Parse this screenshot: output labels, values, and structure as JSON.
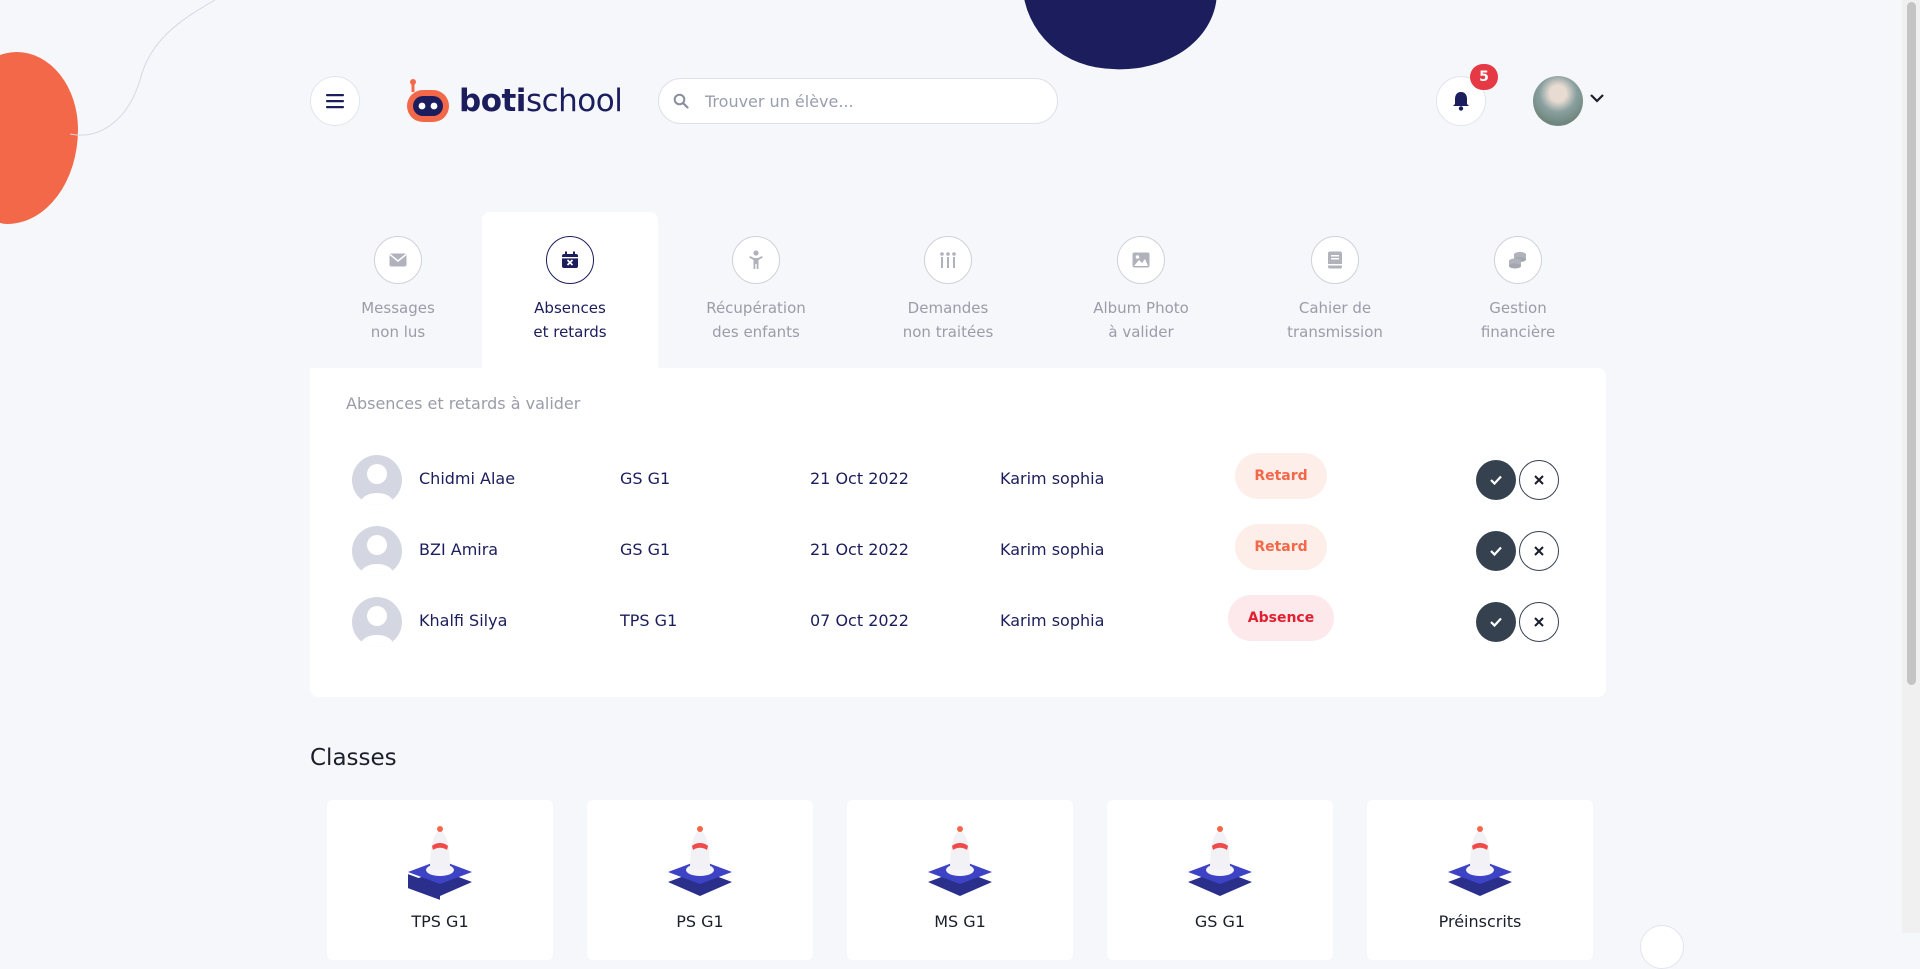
{
  "app": {
    "brand_part1": "boti",
    "brand_part2": "school"
  },
  "header": {
    "menu_icon": "hamburger-icon",
    "search": {
      "placeholder": "Trouver un élève...",
      "icon": "search-icon"
    },
    "notifications": {
      "icon": "bell-icon",
      "count": "5"
    },
    "user_menu": {
      "icon": "chevron-down-icon"
    }
  },
  "tabs": [
    {
      "line1": "Messages",
      "line2": "non lus",
      "icon": "envelope-icon",
      "active": false
    },
    {
      "line1": "Absences",
      "line2": "et retards",
      "icon": "calendar-x-icon",
      "active": true
    },
    {
      "line1": "Récupération",
      "line2": "des enfants",
      "icon": "child-icon",
      "active": false
    },
    {
      "line1": "Demandes",
      "line2": "non traitées",
      "icon": "list-icon",
      "active": false
    },
    {
      "line1": "Album Photo",
      "line2": "à valider",
      "icon": "image-icon",
      "active": false
    },
    {
      "line1": "Cahier de",
      "line2": "transmission",
      "icon": "book-icon",
      "active": false
    },
    {
      "line1": "Gestion",
      "line2": "financière",
      "icon": "coins-icon",
      "active": false
    }
  ],
  "panel": {
    "title": "Absences et retards à valider",
    "rows": [
      {
        "name": "Chidmi Alae",
        "class": "GS G1",
        "date": "21 Oct 2022",
        "teacher": "Karim sophia",
        "status": "Retard"
      },
      {
        "name": "BZI Amira",
        "class": "GS G1",
        "date": "21 Oct 2022",
        "teacher": "Karim sophia",
        "status": "Retard"
      },
      {
        "name": "Khalfi Silya",
        "class": "TPS G1",
        "date": "07 Oct 2022",
        "teacher": "Karim sophia",
        "status": "Absence"
      }
    ]
  },
  "classes": {
    "title": "Classes",
    "items": [
      {
        "name": "TPS G1"
      },
      {
        "name": "PS G1"
      },
      {
        "name": "MS G1"
      },
      {
        "name": "GS G1"
      },
      {
        "name": "Préinscrits"
      }
    ]
  },
  "colors": {
    "accent": "#f26849",
    "navy": "#1b1d5c",
    "danger": "#e53945"
  }
}
